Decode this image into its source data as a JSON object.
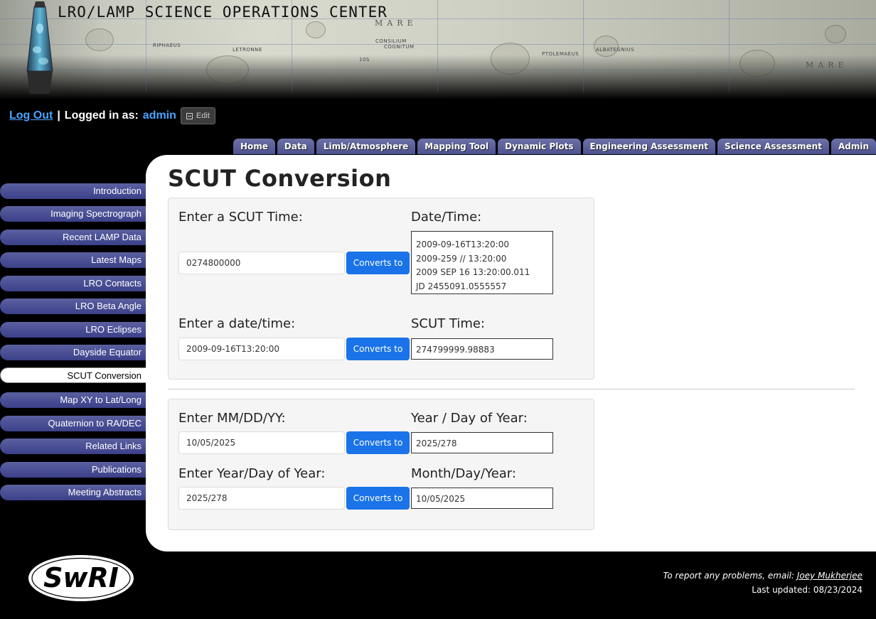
{
  "header": {
    "site_title": "LRO/LAMP SCIENCE OPERATIONS CENTER",
    "map_labels": [
      "MARE",
      "CONSILIUM",
      "COGNITUM",
      "RIPHAEUS",
      "LETRONNE",
      "PTOLEMAEUS",
      "ALBATEGNIUS",
      "MARE",
      "10S"
    ]
  },
  "login": {
    "logout_label": "Log Out",
    "separator": "|",
    "logged_in_label": "Logged in as:",
    "username": "admin",
    "edit_label": "Edit"
  },
  "top_nav": [
    {
      "label": "Home"
    },
    {
      "label": "Data"
    },
    {
      "label": "Limb/Atmosphere"
    },
    {
      "label": "Mapping Tool"
    },
    {
      "label": "Dynamic Plots"
    },
    {
      "label": "Engineering Assessment"
    },
    {
      "label": "Science Assessment"
    },
    {
      "label": "Admin"
    }
  ],
  "sidebar": [
    {
      "label": "Introduction"
    },
    {
      "label": "Imaging Spectrograph"
    },
    {
      "label": "Recent LAMP Data"
    },
    {
      "label": "Latest Maps"
    },
    {
      "label": "LRO Contacts"
    },
    {
      "label": "LRO Beta Angle"
    },
    {
      "label": "LRO Eclipses"
    },
    {
      "label": "Dayside Equator"
    },
    {
      "label": "SCUT Conversion",
      "active": true
    },
    {
      "label": "Map XY to Lat/Long"
    },
    {
      "label": "Quaternion to RA/DEC"
    },
    {
      "label": "Related Links"
    },
    {
      "label": "Publications"
    },
    {
      "label": "Meeting Abstracts"
    }
  ],
  "main": {
    "page_title": "SCUT Conversion",
    "scut_panel": {
      "scut_in_label": "Enter a SCUT Time:",
      "scut_in_value": "0274800000",
      "convert_label": "Converts to",
      "datetime_out_label": "Date/Time:",
      "datetime_out_lines": [
        "2009-09-16T13:20:00",
        "2009-259 // 13:20:00",
        "2009 SEP 16 13:20:00.011",
        "JD 2455091.0555557"
      ],
      "date_in_label": "Enter a date/time:",
      "date_in_value": "2009-09-16T13:20:00",
      "scut_out_label": "SCUT Time:",
      "scut_out_value": "274799999.98883"
    },
    "date_panel": {
      "mdy_in_label": "Enter MM/DD/YY:",
      "mdy_in_value": "10/05/2025",
      "convert_label": "Converts to",
      "ydoy_out_label": "Year / Day of Year:",
      "ydoy_out_value": "2025/278",
      "ydoy_in_label": "Enter Year/Day of Year:",
      "ydoy_in_value": "2025/278",
      "mdy_out_label": "Month/Day/Year:",
      "mdy_out_value": "10/05/2025"
    }
  },
  "footer": {
    "logo_text": "SwRI",
    "report_text": "To report any problems, email:",
    "contact_name": "Joey Mukherjee",
    "updated_text": "Last updated: 08/23/2024"
  },
  "colors": {
    "nav_tab": "#5a5f9c",
    "link": "#4aa3ff",
    "button": "#1a73e8"
  }
}
